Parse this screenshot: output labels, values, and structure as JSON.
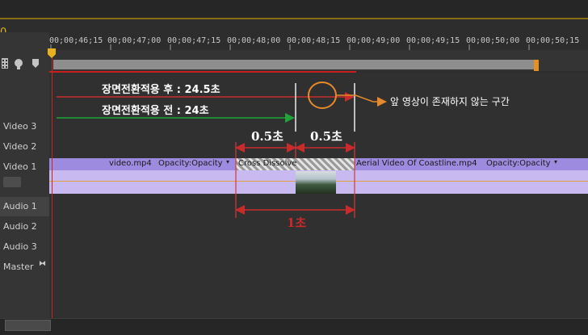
{
  "header": {
    "orange_mark": "0"
  },
  "ruler": {
    "ticks": [
      "00;00;46;15",
      "00;00;47;00",
      "00;00;47;15",
      "00;00;48;00",
      "00;00;48;15",
      "00;00;49;00",
      "00;00;49;15",
      "00;00;50;00",
      "00;00;50;15"
    ]
  },
  "tracks": {
    "video3": "Video 3",
    "video2": "Video 2",
    "video1": "Video 1",
    "audio1": "Audio 1",
    "audio2": "Audio 2",
    "audio3": "Audio 3",
    "master": "Master"
  },
  "clips": {
    "left_name": "video.mp4",
    "left_effect": "Opacity:Opacity",
    "transition": "Cross Dissolve",
    "right_name": "Aerial Video Of Coastline.mp4",
    "right_effect": "Opacity:Opacity"
  },
  "annotations": {
    "after_label": "장면전환적용 후 : 24.5초",
    "before_label": "장면전환적용 전 : 24초",
    "gap_note": "앞 영상이 존재하지 않는 구간",
    "half_left": "0.5초",
    "half_right": "0.5초",
    "total": "1초"
  },
  "colors": {
    "arrow_red": "#c92a2a",
    "arrow_green": "#1fa43a",
    "circle_orange": "#e48a2c"
  },
  "icons": [
    "film-icon",
    "marker-icon",
    "snap-icon"
  ]
}
